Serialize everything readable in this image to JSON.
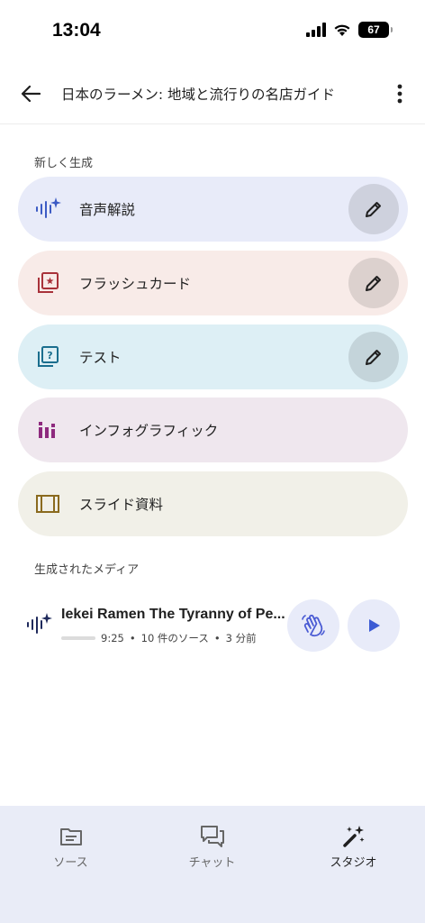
{
  "status_bar": {
    "time": "13:04",
    "battery": "67"
  },
  "header": {
    "title": "日本のラーメン: 地域と流行りの名店ガイド"
  },
  "generate_section": {
    "label": "新しく生成",
    "cards": [
      {
        "id": "audio",
        "label": "音声解説",
        "icon": "audio-sparkle-icon",
        "bg": "#e8ebf9",
        "icon_color": "#3c5bc4",
        "has_edit": true
      },
      {
        "id": "flashcard",
        "label": "フラッシュカード",
        "icon": "flashcard-icon",
        "bg": "#f8ebe8",
        "icon_color": "#a8323a",
        "has_edit": true
      },
      {
        "id": "quiz",
        "label": "テスト",
        "icon": "quiz-icon",
        "bg": "#ddeff5",
        "icon_color": "#1a6e8e",
        "has_edit": true
      },
      {
        "id": "infographic",
        "label": "インフォグラフィック",
        "icon": "infographic-icon",
        "bg": "#efe7ee",
        "icon_color": "#8e2a7e",
        "has_edit": false
      },
      {
        "id": "slides",
        "label": "スライド資料",
        "icon": "slides-icon",
        "bg": "#f1f0e8",
        "icon_color": "#8a6a1e",
        "has_edit": false
      }
    ]
  },
  "media_section": {
    "label": "生成されたメディア",
    "items": [
      {
        "title": "Iekei Ramen The Tyranny of Pe...",
        "duration": "9:25",
        "sources": "10 件のソース",
        "age": "3 分前",
        "progress": 0
      }
    ]
  },
  "bottom_nav": {
    "items": [
      {
        "label": "ソース",
        "icon": "sources-icon",
        "active": false
      },
      {
        "label": "チャット",
        "icon": "chat-icon",
        "active": false
      },
      {
        "label": "スタジオ",
        "icon": "studio-icon",
        "active": true
      }
    ]
  }
}
